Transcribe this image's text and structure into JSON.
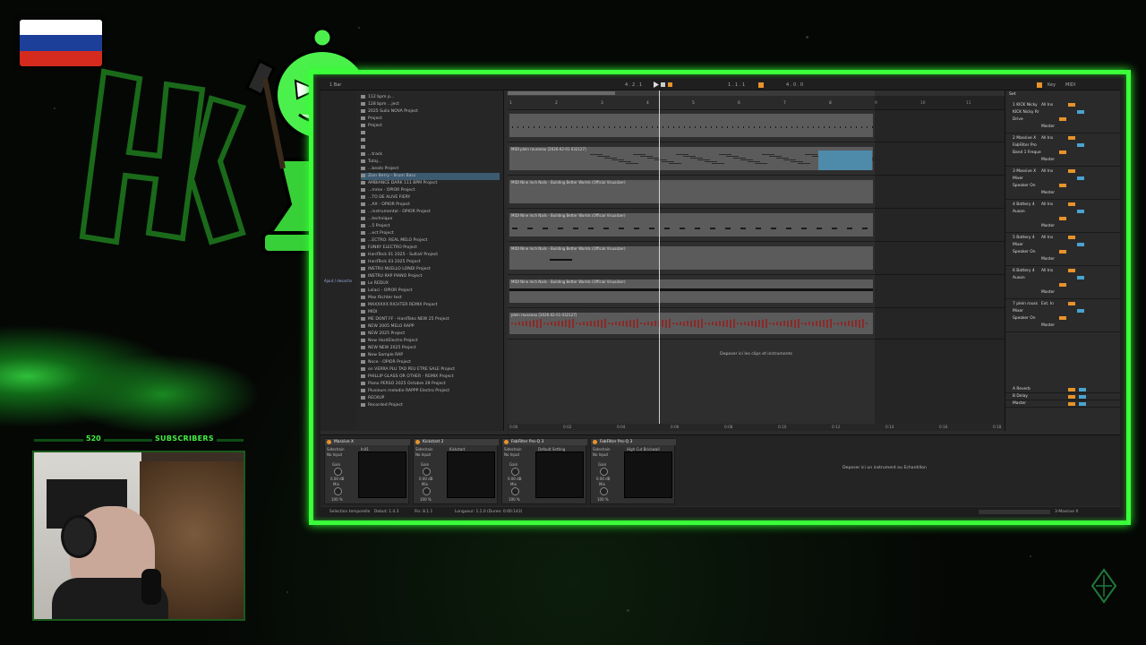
{
  "overlay": {
    "subscriber_count": "520",
    "subscriber_label": "SUBSCRIBERS",
    "flag_colors": [
      "#ffffff",
      "#1c3f9a",
      "#d52b1e"
    ],
    "accent_green": "#3aff3a"
  },
  "daw": {
    "topbar": {
      "meter": "1 Bar",
      "position": "4 . 2 . 1",
      "loop_start": "1 . 1 . 1",
      "loop_length": "4 . 0 . 0",
      "key_label": "Key",
      "midi_label": "MIDI"
    },
    "browser_items": [
      "112 bpm p...",
      "128 bpm ...ject",
      "2025 Sulio NOVA Project",
      "Project",
      "Project",
      "",
      "",
      "",
      "...track",
      "Tutaj...",
      "...beats Project",
      "Zion Berry - Brum Bass",
      "AMBIANCE DARK 111 BPM Project",
      "...mme - OPIOR Project",
      "...TO DE ALIVE FIERY",
      "...AX - OPIOR Project",
      "...instrumental - OPIOR Project",
      "...technique",
      "...5 Project",
      "...ect Project",
      "...ECTRO: REAL MELO Project",
      "FUNKY ELECTRO Project",
      "HardTeck 01 2025 - SultaV Project",
      "HardTeck 03 2025 Project",
      "INSTRU NUELLO LONDI Project",
      "INSTRU RAP PIANO Project",
      "Le REDUX",
      "Lolaci - OPIOR Project",
      "Max Richter test",
      "MAXXXXX RICHTER REMIX Project",
      "MIDI",
      "ME DONT FF - HardTeks NEW 25 Project",
      "NEW 2005 MELO RAPP",
      "NEW 2025 Project",
      "New HardElectro Project",
      "NEW NEW 2025 Project",
      "New Sample RAP",
      "Noce - OPIOR Project",
      "on VERRA PLU TAD PEU ETRE SALE Project",
      "PHILLIP GLASS OR OTHER - REMIX Project",
      "Piano PERSO 2025 Octobre 29 Project",
      "Plusieurs melodie RAPPP Electro Project",
      "RECKUP",
      "Recorded Project"
    ],
    "browser_sidebar_label": "Ajout / desactiv",
    "ruler_marks": [
      "1",
      "2",
      "3",
      "4",
      "5",
      "6",
      "7",
      "8",
      "9",
      "10",
      "11"
    ],
    "time_marks": [
      "0:00",
      "0:02",
      "0:04",
      "0:06",
      "0:08",
      "0:10",
      "0:12",
      "0:14",
      "0:16",
      "0:18"
    ],
    "tracks": [
      {
        "clip": ""
      },
      {
        "clip": "MIDI plein rousseau [2026-02-01 032127]"
      },
      {
        "clip": "MIDI Nine Inch Nails - Building Better Worlds (Official Visualizer)"
      },
      {
        "clip": "MIDI Nine Inch Nails - Building Better Worlds (Official Visualizer)"
      },
      {
        "clip": "MIDI Nine Inch Nails - Building Better Worlds (Official Visualizer)"
      },
      {
        "clip": "MIDI Nine Inch Nails - Building Better Worlds (Official Visualizer)"
      },
      {
        "clip": "plein rousseau [2026-02-01 032127]"
      }
    ],
    "drop_hint": "Deposer ici les clips et instruments",
    "mixer": {
      "set_label": "Set",
      "strips": [
        {
          "name": "1 KICK Nicky",
          "input": "All Ins",
          "device": "KICK Nicky Rr",
          "monitor": "Drive",
          "out": "Master"
        },
        {
          "name": "2 Massive X",
          "input": "All Ins",
          "device": "FabFilter Pro",
          "monitor": "Band 1 Freque",
          "out": "Master"
        },
        {
          "name": "3 Massive X",
          "input": "All Ins",
          "device": "Mixer",
          "monitor": "Speaker On",
          "out": "Master"
        },
        {
          "name": "4 Battery 4",
          "input": "All Ins",
          "device": "Auxon",
          "monitor": "",
          "out": "Master"
        },
        {
          "name": "5 Battery 4",
          "input": "All Ins",
          "device": "Mixer",
          "monitor": "Speaker On",
          "out": "Master"
        },
        {
          "name": "6 Battery 4",
          "input": "All Ins",
          "device": "Auxon",
          "monitor": "",
          "out": "Master"
        },
        {
          "name": "7 plein rouss",
          "input": "Ext. In",
          "device": "Mixer",
          "monitor": "Speaker On",
          "out": "Master"
        }
      ],
      "returns": [
        "A Reverb",
        "B Delay",
        "Master"
      ]
    },
    "devices": [
      {
        "title": "Massive X",
        "preset": "Init1",
        "sidechain": "Sidechain",
        "noinput": "No Input",
        "gain": "Gain",
        "db": "0.00 dB",
        "mix": "Mix",
        "pct": "100 %"
      },
      {
        "title": "Kickstart 2",
        "preset": "Kickstart",
        "sidechain": "Sidechain",
        "noinput": "No Input",
        "gain": "Gain",
        "db": "0.00 dB",
        "mix": "Mix",
        "pct": "100 %"
      },
      {
        "title": "FabFilter Pro-Q 3",
        "preset": "Default Setting",
        "sidechain": "Sidechain",
        "noinput": "No Input",
        "gain": "Gain",
        "db": "0.00 dB",
        "mix": "Mix",
        "pct": "100 %"
      },
      {
        "title": "FabFilter Pro-Q 3",
        "preset": "High Cut Brickwall",
        "sidechain": "Sidechain",
        "noinput": "No Input",
        "gain": "Gain",
        "db": "0.00 dB",
        "mix": "Mix",
        "pct": "100 %"
      }
    ],
    "device_drop_hint": "Deposer ici un instrument ou Echantillon",
    "status": {
      "selection": "Selection temporelle",
      "start": "Debut: 1.4.3",
      "end": "Fin: 8.1.1",
      "length": "Longueur: 1.1.0 (Duree: 0:00:143)",
      "right": "3-Massive X"
    }
  }
}
